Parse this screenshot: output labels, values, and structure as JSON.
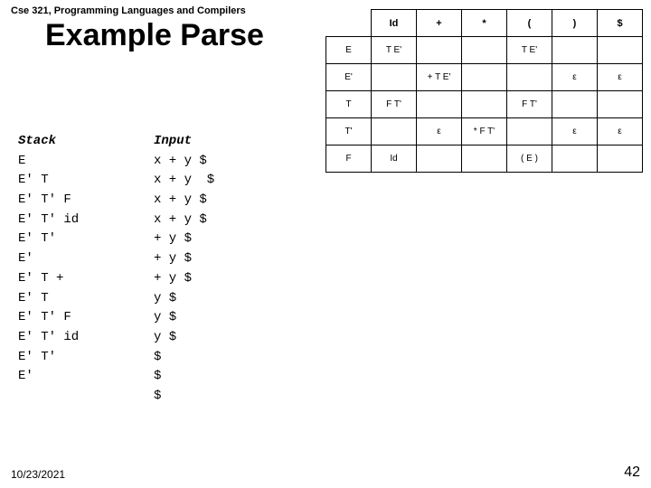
{
  "course": "Cse 321, Programming Languages and Compilers",
  "title": "Example Parse",
  "date": "10/23/2021",
  "page": "42",
  "trace": {
    "head_stack": "Stack",
    "head_input": "Input",
    "rows": [
      {
        "stack": "E",
        "input": "x + y $"
      },
      {
        "stack": "E' T",
        "input": "x + y  $"
      },
      {
        "stack": "E' T' F",
        "input": "x + y $"
      },
      {
        "stack": "E' T' id",
        "input": "x + y $"
      },
      {
        "stack": "E' T'",
        "input": "+ y $"
      },
      {
        "stack": "E'",
        "input": "+ y $"
      },
      {
        "stack": "E' T +",
        "input": "+ y $"
      },
      {
        "stack": "E' T",
        "input": "y $"
      },
      {
        "stack": "E' T' F",
        "input": "y $"
      },
      {
        "stack": "E' T' id",
        "input": "y $"
      },
      {
        "stack": "E' T'",
        "input": "$"
      },
      {
        "stack": "E'",
        "input": "$"
      },
      {
        "stack": "",
        "input": "$"
      }
    ]
  },
  "table": {
    "cols": [
      "Id",
      "+",
      "*",
      "(",
      ")",
      "$"
    ],
    "rows": [
      {
        "h": "E",
        "c": [
          "T E'",
          "",
          "",
          "T E'",
          "",
          ""
        ]
      },
      {
        "h": "E'",
        "c": [
          "",
          "+ T E'",
          "",
          "",
          "ε",
          "ε"
        ]
      },
      {
        "h": "T",
        "c": [
          "F T'",
          "",
          "",
          "F T'",
          "",
          ""
        ]
      },
      {
        "h": "T'",
        "c": [
          "",
          "ε",
          "* F T'",
          "",
          "ε",
          "ε"
        ]
      },
      {
        "h": "F",
        "c": [
          "Id",
          "",
          "",
          "( E )",
          "",
          ""
        ]
      }
    ]
  }
}
